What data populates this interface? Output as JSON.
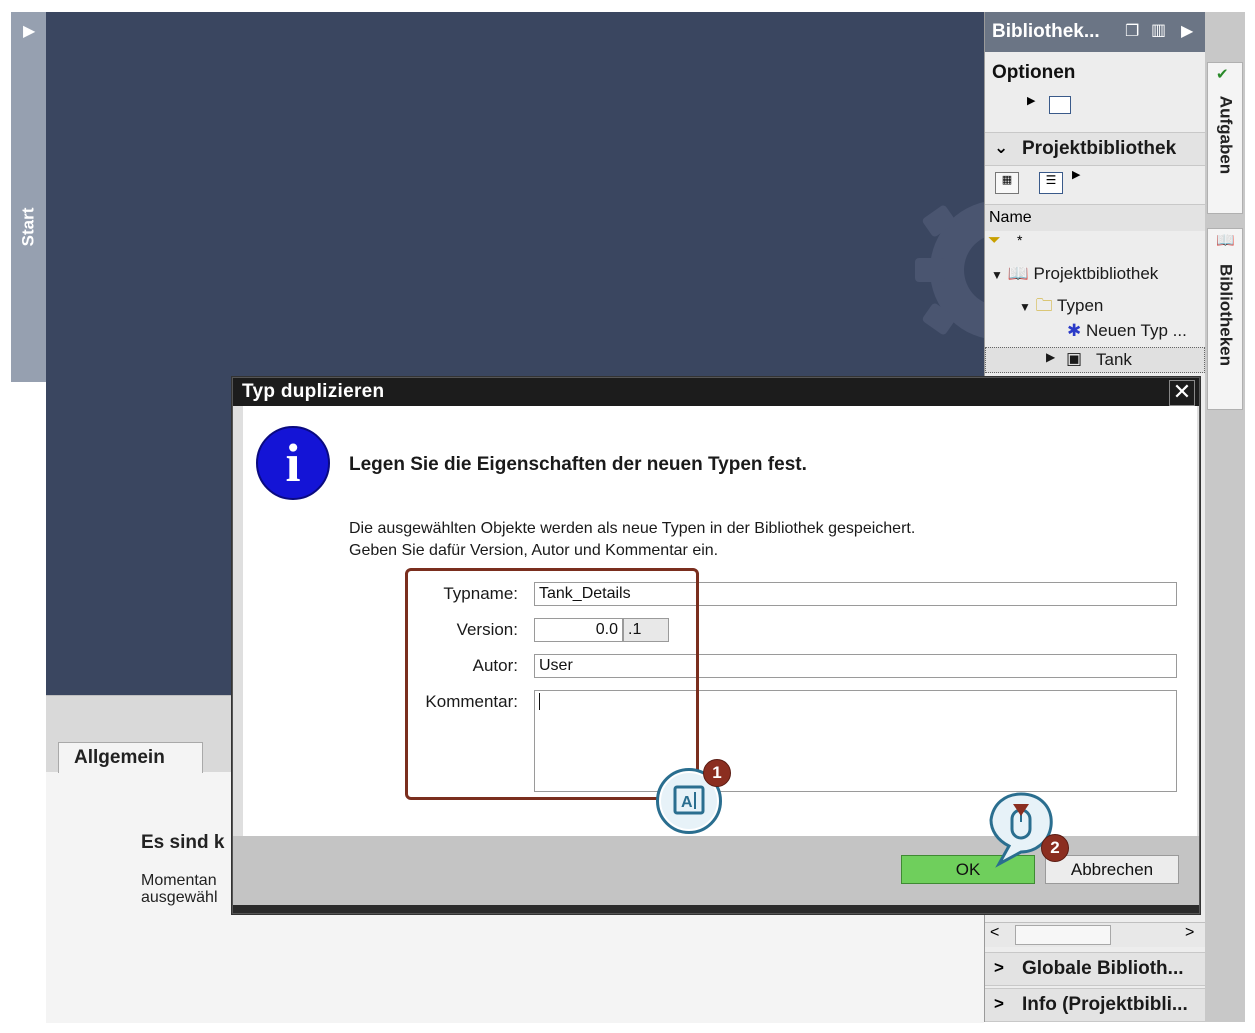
{
  "start_strip": {
    "label": "Start"
  },
  "library_panel": {
    "header_title": "Bibliothek...",
    "options_label": "Optionen",
    "project_library_label": "Projektbibliothek",
    "name_column": "Name",
    "filter_text": "*",
    "tree": {
      "root": "Projektbibliothek",
      "types": "Typen",
      "new_type": "Neuen Typ ...",
      "tank": "Tank"
    },
    "global_library_label": "Globale Biblioth...",
    "info_label": "Info (Projektbibli..."
  },
  "vertical_tabs": {
    "tasks": "Aufgaben",
    "libraries": "Bibliotheken"
  },
  "inspector": {
    "tab_general": "Allgemein",
    "title_partial": "Es sind k",
    "text_line1": "Momentan",
    "text_line2": "ausgewähl"
  },
  "dialog": {
    "title": "Typ duplizieren",
    "close_symbol": "✕",
    "heading": "Legen Sie die Eigenschaften der neuen Typen fest.",
    "description_line1": "Die ausgewählten Objekte werden als neue Typen in der Bibliothek gespeichert.",
    "description_line2": "Geben Sie dafür Version, Autor und Kommentar ein.",
    "fields": {
      "typename_label": "Typname:",
      "typename_value": "Tank_Details",
      "version_label": "Version:",
      "version_major": "0.0",
      "version_minor": ".1",
      "author_label": "Autor:",
      "author_value": "User",
      "comment_label": "Kommentar:",
      "comment_value": ""
    },
    "ok_label": "OK",
    "cancel_label": "Abbrechen"
  },
  "callouts": {
    "step1": "1",
    "step2": "2"
  },
  "colors": {
    "main_background": "#3a4660",
    "ok_button": "#6fcf5c",
    "callout_badge": "#8b2e20",
    "highlight_box": "#7a2e1e",
    "info_icon": "#1414d6"
  }
}
